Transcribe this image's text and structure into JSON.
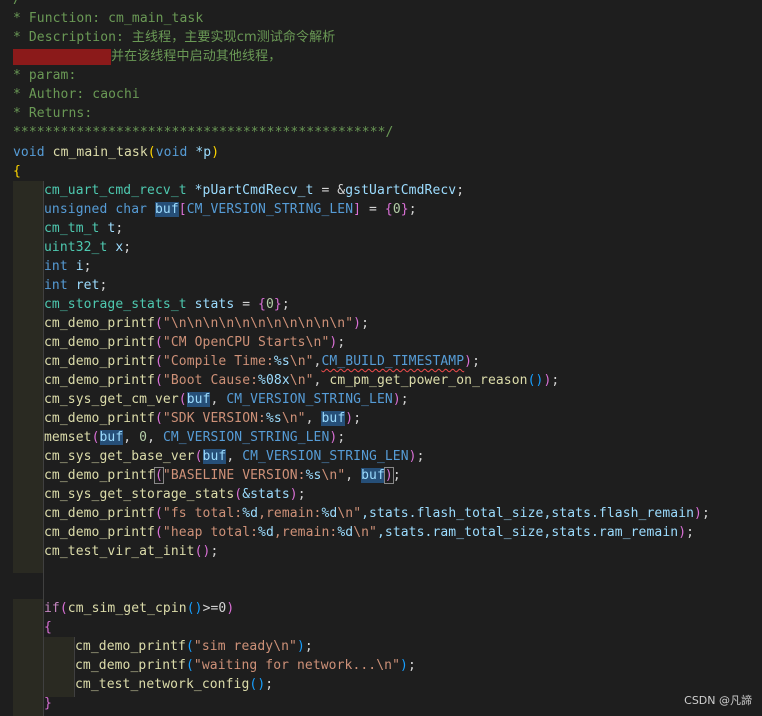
{
  "comment": {
    "l1": "/",
    "l2": "* Function: cm_main_task",
    "l3_prefix": "* Description: ",
    "l3_text": "主线程，主要实现cm测试命令解析",
    "l4_text": "并在该线程中启动其他线程，",
    "l5": "* param:",
    "l6": "* Author: caochi",
    "l7": "* Returns:",
    "l8": "***********************************************/"
  },
  "code": {
    "sig_void": "void",
    "sig_name": "cm_main_task",
    "sig_param_type": "void",
    "sig_param": "*p",
    "open_brace": "{",
    "l_recv_type": "cm_uart_cmd_recv_t",
    "l_recv_var": "*pUartCmdRecv_t",
    "l_recv_rest": " = &",
    "l_recv_val": "gstUartCmdRecv",
    "l_buf_kw": "unsigned char",
    "l_buf_var": "buf",
    "l_buf_macro": "CM_VERSION_STRING_LEN",
    "l_buf_zero": "0",
    "l_tm_type": "cm_tm_t",
    "l_tm_var": "t",
    "l_u32_type": "uint32_t",
    "l_u32_var": "x",
    "l_int1_kw": "int",
    "l_int1_var": "i",
    "l_int2_kw": "int",
    "l_int2_var": "ret",
    "l_stats_type": "cm_storage_stats_t",
    "l_stats_var": "stats",
    "l_stats_zero": "0",
    "p1_fn": "cm_demo_printf",
    "p1_str": "\"\\n\\n\\n\\n\\n\\n\\n\\n\\n\\n\\n\"",
    "p2_fn": "cm_demo_printf",
    "p2_str": "\"CM OpenCPU Starts\\n\"",
    "p3_fn": "cm_demo_printf",
    "p3_str_a": "\"Compile Time:",
    "p3_fmt": "%s",
    "p3_str_b": "\\n\"",
    "p3_macro": "CM_BUILD_TIMESTAMP",
    "p4_fn": "cm_demo_printf",
    "p4_str_a": "\"Boot Cause:",
    "p4_fmt": "%08x",
    "p4_str_b": "\\n\"",
    "p4_call": "cm_pm_get_power_on_reason",
    "v1_fn": "cm_sys_get_cm_ver",
    "v1_arg": "buf",
    "v1_macro": "CM_VERSION_STRING_LEN",
    "p5_fn": "cm_demo_printf",
    "p5_str_a": "\"SDK VERSION:",
    "p5_fmt": "%s",
    "p5_str_b": "\\n\"",
    "p5_arg": "buf",
    "ms_fn": "memset",
    "ms_arg": "buf",
    "ms_zero": "0",
    "ms_macro": "CM_VERSION_STRING_LEN",
    "v2_fn": "cm_sys_get_base_ver",
    "v2_arg": "buf",
    "v2_macro": "CM_VERSION_STRING_LEN",
    "p6_fn": "cm_demo_printf",
    "p6_str_a": "\"BASELINE VERSION:",
    "p6_fmt": "%s",
    "p6_str_b": "\\n\"",
    "p6_arg": "buf",
    "st_fn": "cm_sys_get_storage_stats",
    "st_arg": "&stats",
    "p7_fn": "cm_demo_printf",
    "p7_str_a": "\"fs total:",
    "p7_fmt1": "%d",
    "p7_str_b": ",remain:",
    "p7_fmt2": "%d",
    "p7_str_c": "\\n\"",
    "p7_args": ",stats.flash_total_size,stats.flash_remain",
    "p8_fn": "cm_demo_printf",
    "p8_str_a": "\"heap total:",
    "p8_fmt1": "%d",
    "p8_str_b": ",remain:",
    "p8_fmt2": "%d",
    "p8_str_c": "\\n\"",
    "p8_args": ",stats.ram_total_size,stats.ram_remain",
    "vir_fn": "cm_test_vir_at_init",
    "if_kw": "if",
    "if_fn": "cm_sim_get_cpin",
    "if_rest": ">=0",
    "if_open": "{",
    "s1_fn": "cm_demo_printf",
    "s1_str": "\"sim ready\\n\"",
    "s2_fn": "cm_demo_printf",
    "s2_str": "\"waiting for network...\\n\"",
    "nc_fn": "cm_test_network_config",
    "if_close": "}"
  },
  "watermark": "CSDN @凡諦",
  "colors": {
    "background": "#1e1e1e",
    "comment": "#6a9955",
    "keyword": "#569cd6",
    "function": "#dcdcaa",
    "type": "#4ec9b0",
    "variable": "#9cdcfe",
    "string": "#ce9178",
    "number": "#b5cea8",
    "redaction": "#8b1a1a"
  }
}
